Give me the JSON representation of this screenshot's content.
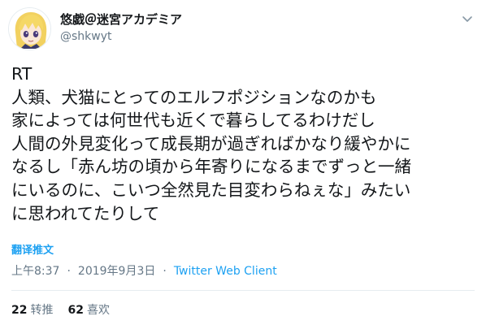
{
  "user": {
    "display_name": "悠戯＠迷宮アカデミア",
    "handle": "@shkwyt"
  },
  "tweet": {
    "lines": [
      "RT",
      "人類、犬猫にとってのエルフポジションなのかも",
      "家によっては何世代も近くで暮らしてるわけだし",
      "人間の外見変化って成長期が過ぎればかなり緩やかに",
      "なるし「赤ん坊の頃から年寄りになるまでずっと一緒",
      "にいるのに、こいつ全然見た目変わらねぇな」みたい",
      "に思われてたりして"
    ],
    "translate_label": "翻译推文",
    "time": "上午8:37",
    "date": "2019年9月3日",
    "client": "Twitter Web Client",
    "separator": "·"
  },
  "stats": {
    "retweets_count": "22",
    "retweets_label": "转推",
    "likes_count": "62",
    "likes_label": "喜欢"
  },
  "icons": {
    "avatar": "anime-avatar-icon",
    "caret": "chevron-down-icon"
  },
  "colors": {
    "link": "#1da1f2",
    "secondary_text": "#657786",
    "primary_text": "#14171a",
    "divider": "#e6ecf0"
  }
}
